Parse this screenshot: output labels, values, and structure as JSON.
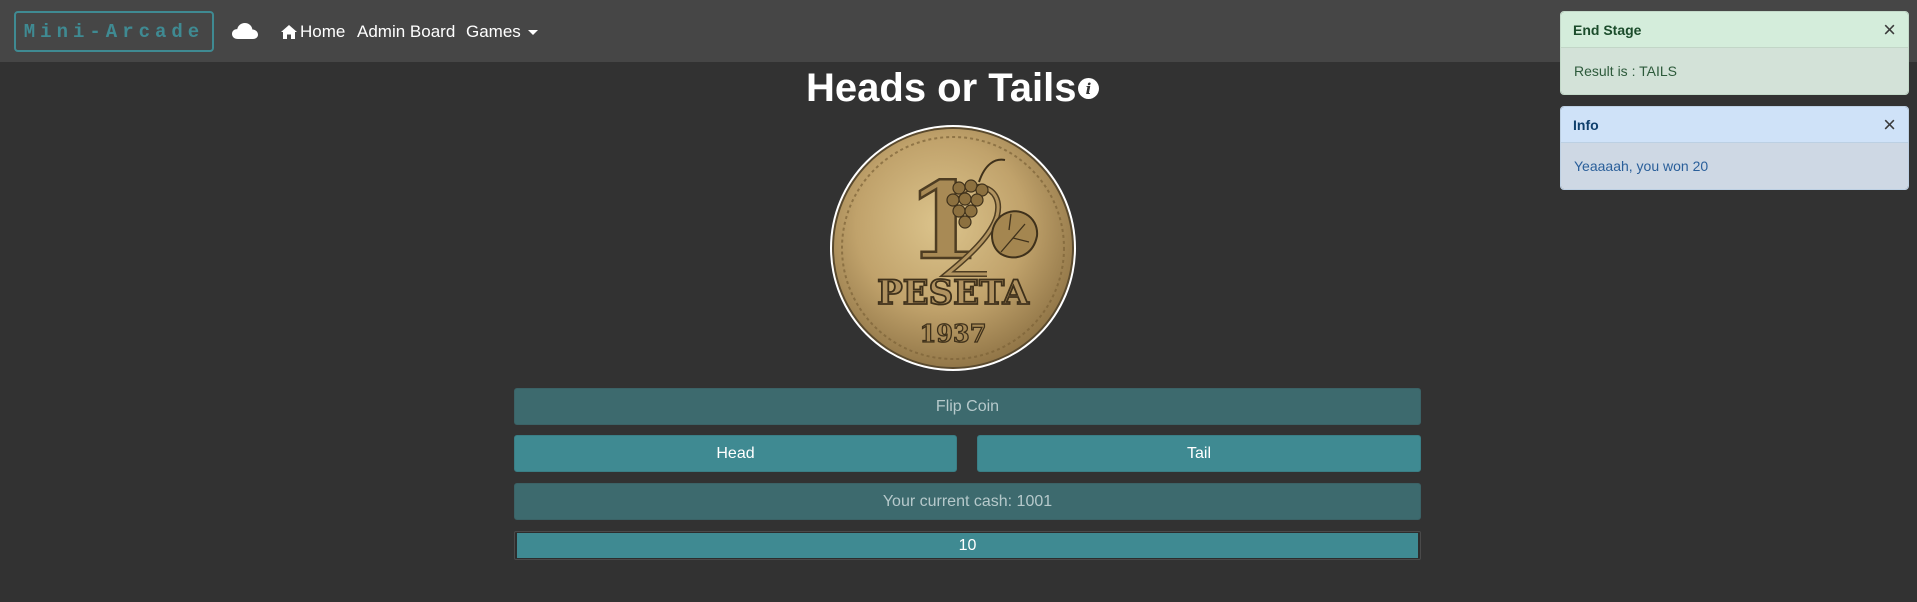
{
  "navbar": {
    "brand": "Mini-Arcade",
    "home_label": "Home",
    "admin_label": "Admin Board",
    "games_label": "Games"
  },
  "game": {
    "title": "Heads or Tails",
    "flip_label": "Flip Coin",
    "head_label": "Head",
    "tail_label": "Tail",
    "cash_label": "Your current cash: 1001",
    "bet_value": "10",
    "coin_image": {
      "numeral": "1",
      "word": "PESETA",
      "year": "1937"
    }
  },
  "toasts": [
    {
      "title": "End Stage",
      "message": "Result is : TAILS",
      "close": "×",
      "type": "success"
    },
    {
      "title": "Info",
      "message": "Yeaaaah, you won 20",
      "close": "×",
      "type": "info"
    }
  ],
  "colors": {
    "accent": "#3f8a92",
    "background": "#323232",
    "navbar": "#464646"
  }
}
